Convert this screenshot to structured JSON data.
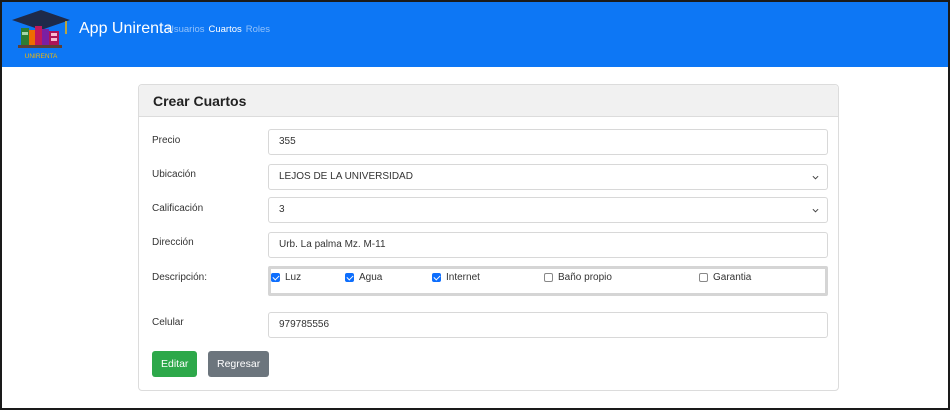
{
  "app": {
    "brand": "App Unirenta",
    "logo_text": "UNIRENTA"
  },
  "nav": {
    "links": [
      {
        "label": "Usuarios",
        "active": false
      },
      {
        "label": "Cuartos",
        "active": true
      },
      {
        "label": "Roles",
        "active": false
      }
    ]
  },
  "form": {
    "title": "Crear Cuartos",
    "precio": {
      "label": "Precio",
      "value": "355"
    },
    "ubicacion": {
      "label": "Ubicación",
      "value": "LEJOS DE LA UNIVERSIDAD"
    },
    "calificacion": {
      "label": "Calificación",
      "value": "3"
    },
    "direccion": {
      "label": "Dirección",
      "value": "Urb. La palma Mz. M-11"
    },
    "descripcion": {
      "label": "Descripción:",
      "options": [
        {
          "label": "Luz",
          "checked": true
        },
        {
          "label": "Agua",
          "checked": true
        },
        {
          "label": "Internet",
          "checked": true
        },
        {
          "label": "Baño propio",
          "checked": false
        },
        {
          "label": "Garantia",
          "checked": false
        }
      ]
    },
    "celular": {
      "label": "Celular",
      "value": "979785556"
    },
    "buttons": {
      "edit": "Editar",
      "back": "Regresar"
    }
  },
  "colors": {
    "navbar": "#0d77f5",
    "edit_button": "#2da84a",
    "back_button": "#6c757d",
    "checkbox_checked": "#0d6efd"
  }
}
